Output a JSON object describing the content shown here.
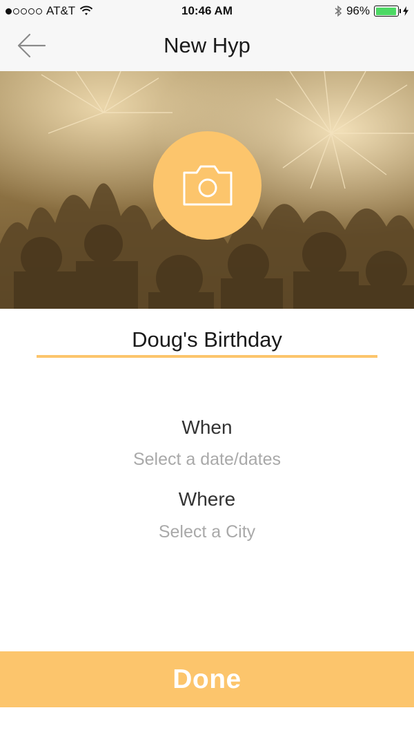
{
  "status_bar": {
    "carrier": "AT&T",
    "time": "10:46 AM",
    "battery": "96%",
    "battery_level": 0.96
  },
  "nav": {
    "title": "New Hyp",
    "back_icon": "arrow-left-icon"
  },
  "hero": {
    "camera_icon": "camera-icon"
  },
  "form": {
    "event_name": "Doug's Birthday",
    "when_label": "When",
    "when_placeholder": "Select a date/dates",
    "where_label": "Where",
    "where_placeholder": "Select a City"
  },
  "actions": {
    "done_label": "Done"
  },
  "colors": {
    "accent": "#fcc56c",
    "battery_green": "#4cd964",
    "placeholder_gray": "#a9a9a9"
  }
}
